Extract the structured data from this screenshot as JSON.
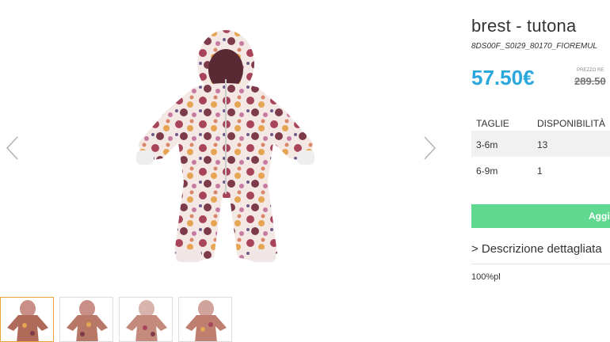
{
  "gallery": {
    "prev_icon": "chevron-left-icon",
    "next_icon": "chevron-right-icon",
    "thumbnails": [
      {
        "alt": "thumbnail-1",
        "active": true
      },
      {
        "alt": "thumbnail-2",
        "active": false
      },
      {
        "alt": "thumbnail-3",
        "active": false
      },
      {
        "alt": "thumbnail-4",
        "active": false
      }
    ]
  },
  "product": {
    "title": "brest - tutona",
    "sku": "8DS00F_S0I29_80170_FIOREMUL",
    "price": "57.50€",
    "retail_label": "PREZZO RE",
    "retail_price": "289.50"
  },
  "sizes": {
    "headers": [
      "TAGLIE",
      "DISPONIBILITÀ"
    ],
    "rows": [
      {
        "size": "3-6m",
        "qty": "13"
      },
      {
        "size": "6-9m",
        "qty": "1"
      }
    ]
  },
  "cart": {
    "add_label": "Aggi"
  },
  "description": {
    "toggle_label": "> Descrizione dettagliata",
    "material": "100%pl"
  },
  "colors": {
    "price": "#2aa7dc",
    "add_button": "#5fd98f",
    "thumb_active_border": "#e8a33a"
  }
}
